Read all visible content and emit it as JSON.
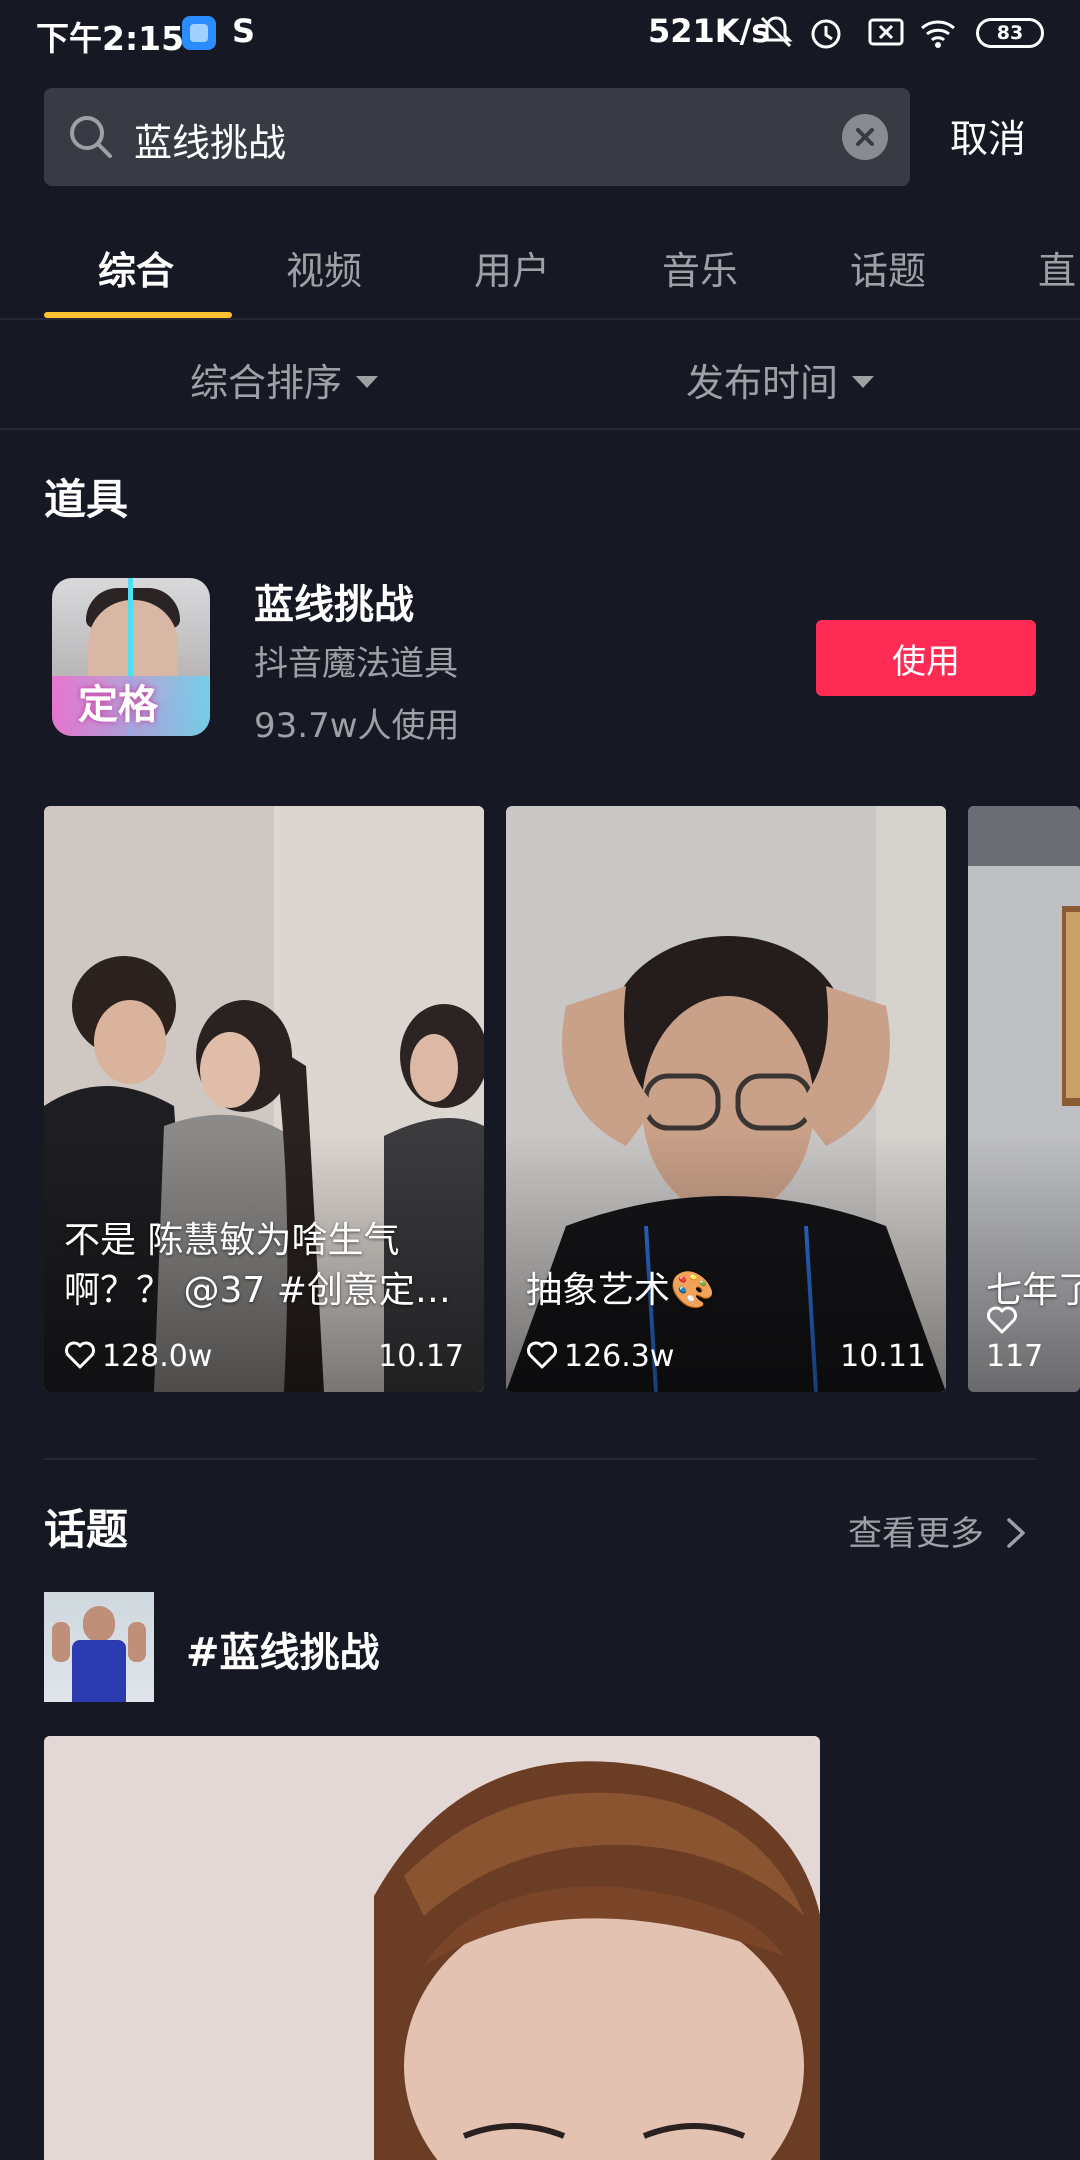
{
  "status_bar": {
    "time": "下午2:15",
    "app_icon_2": "S",
    "net_speed": "521K/s",
    "battery": "83"
  },
  "search": {
    "query": "蓝线挑战",
    "cancel_label": "取消"
  },
  "tabs": [
    {
      "label": "综合",
      "active": true
    },
    {
      "label": "视频",
      "active": false
    },
    {
      "label": "用户",
      "active": false
    },
    {
      "label": "音乐",
      "active": false
    },
    {
      "label": "话题",
      "active": false
    },
    {
      "label": "直",
      "active": false
    }
  ],
  "filters": {
    "sort_label": "综合排序",
    "time_label": "发布时间"
  },
  "props_section": {
    "title": "道具",
    "prop": {
      "thumb_text": "定格",
      "name": "蓝线挑战",
      "subtitle": "抖音魔法道具",
      "usage": "93.7w人使用",
      "use_label": "使用"
    }
  },
  "videos": [
    {
      "title": "不是 陈慧敏为啥生气啊？？ @37 #创意定…",
      "likes": "128.0w",
      "date": "10.17"
    },
    {
      "title": "抽象艺术🎨",
      "likes": "126.3w",
      "date": "10.11"
    },
    {
      "title": "七年了，了……",
      "likes": "117",
      "date": ""
    }
  ],
  "topic_section": {
    "title": "话题",
    "see_more": "查看更多",
    "topic_name": "#蓝线挑战"
  },
  "colors": {
    "background": "#161823",
    "accent_tab": "#f9c22e",
    "use_button": "#fe2c55",
    "muted_text": "#9fa0a6"
  }
}
